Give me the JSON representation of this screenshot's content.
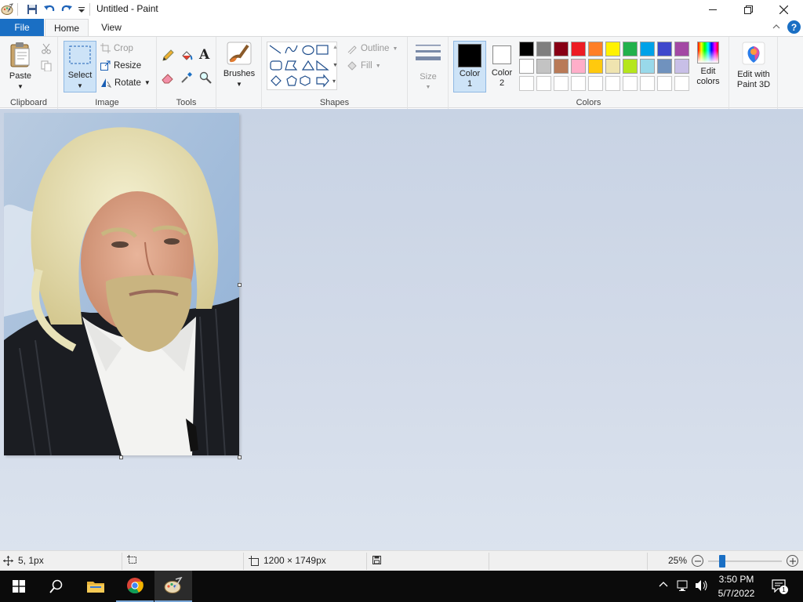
{
  "window": {
    "title": "Untitled - Paint"
  },
  "tabs": [
    {
      "label": "File"
    },
    {
      "label": "Home"
    },
    {
      "label": "View"
    }
  ],
  "ribbon": {
    "clipboard": {
      "paste": "Paste",
      "label": "Clipboard"
    },
    "image": {
      "select": "Select",
      "crop": "Crop",
      "resize": "Resize",
      "rotate": "Rotate",
      "label": "Image"
    },
    "tools": {
      "label": "Tools",
      "text_glyph": "A"
    },
    "brushes": {
      "label": "Brushes"
    },
    "shapes": {
      "outline": "Outline",
      "fill": "Fill",
      "label": "Shapes"
    },
    "size": {
      "label": "Size"
    },
    "colors": {
      "color1": "Color",
      "color1_num": "1",
      "color2": "Color",
      "color2_num": "2",
      "edit": "Edit colors",
      "label": "Colors",
      "color1_value": "#000000",
      "color2_value": "#ffffff",
      "palette_row1": [
        "#000000",
        "#7f7f7f",
        "#880015",
        "#ed1c24",
        "#ff7f27",
        "#fff200",
        "#22b14c",
        "#00a2e8",
        "#3f48cc",
        "#a349a4"
      ],
      "palette_row2": [
        "#ffffff",
        "#c3c3c3",
        "#b97a57",
        "#ffaec9",
        "#ffc90e",
        "#efe4b0",
        "#b5e61d",
        "#99d9ea",
        "#7092be",
        "#c8bfe7"
      ],
      "palette_row3": [
        "#ffffff",
        "#ffffff",
        "#ffffff",
        "#ffffff",
        "#ffffff",
        "#ffffff",
        "#ffffff",
        "#ffffff",
        "#ffffff",
        "#ffffff"
      ]
    },
    "paint3d": {
      "label": "Edit with Paint 3D"
    }
  },
  "status": {
    "cursor": "5, 1px",
    "image_size": "1200 × 1749px",
    "zoom": "25%",
    "zoom_level": 0.25
  },
  "taskbar": {
    "time": "3:50 PM",
    "date": "5/7/2022",
    "notifications": "1"
  }
}
